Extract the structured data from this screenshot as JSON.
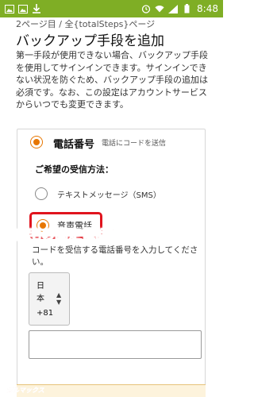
{
  "status_bar": {
    "time": "8:48",
    "left_icons": [
      "image-icon",
      "image-icon",
      "download-icon"
    ],
    "right_icons": [
      "alarm-icon",
      "wifi-icon",
      "signal-icon",
      "battery-icon"
    ]
  },
  "page": {
    "indicator": "2ページ目 / 全{totalSteps}ページ",
    "title": "バックアップ手段を追加",
    "description": "第一手段が使用できない場合、バックアップ手段を使用してサインインできます。サインインできない状況を防ぐため、バックアップ手段の追加は必須です。なお、この設定はアカウントサービスからいつでも変更できます。"
  },
  "phone_option": {
    "label": "電話番号",
    "sublabel": "電話にコードを送信",
    "selected": true
  },
  "method": {
    "label": "ご希望の受信方法：",
    "options": [
      {
        "label": "テキストメッセージ（SMS）",
        "selected": false
      },
      {
        "label": "音声電話",
        "selected": true
      }
    ]
  },
  "code_instruction": "コードを受信する電話番号を入力してください。",
  "country": {
    "name": "日本",
    "code": "+81"
  },
  "annotation": "自宅の固定電話番号",
  "watermark": "ガルマックス",
  "colors": {
    "status_bar": "#7fae25",
    "accent": "#e77600",
    "highlight_border": "#e0141e",
    "annotation": "#e8255e"
  }
}
